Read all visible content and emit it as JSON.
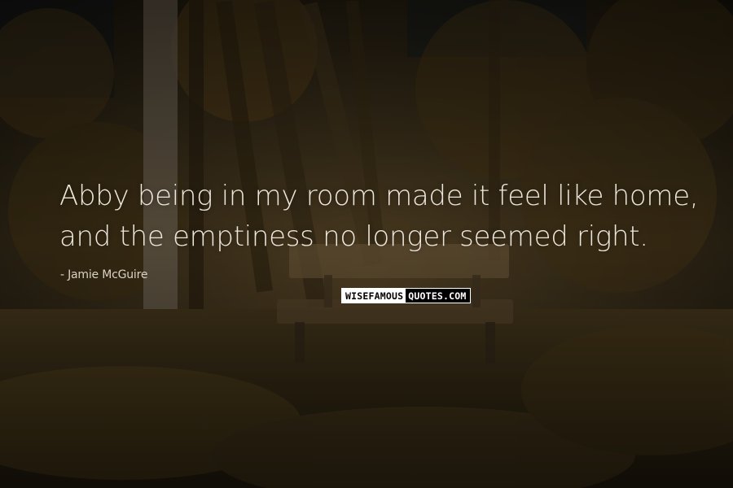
{
  "quote": {
    "lines": [
      "Abby being in my room made it feel like home,",
      "and the emptiness no longer seemed right."
    ],
    "author": "Jamie McGuire"
  },
  "watermark": {
    "part1": "WISEFAMOUS",
    "part2": "QUOTES.COM"
  },
  "colors": {
    "text": "#ece6da",
    "background": "#1a150d"
  }
}
